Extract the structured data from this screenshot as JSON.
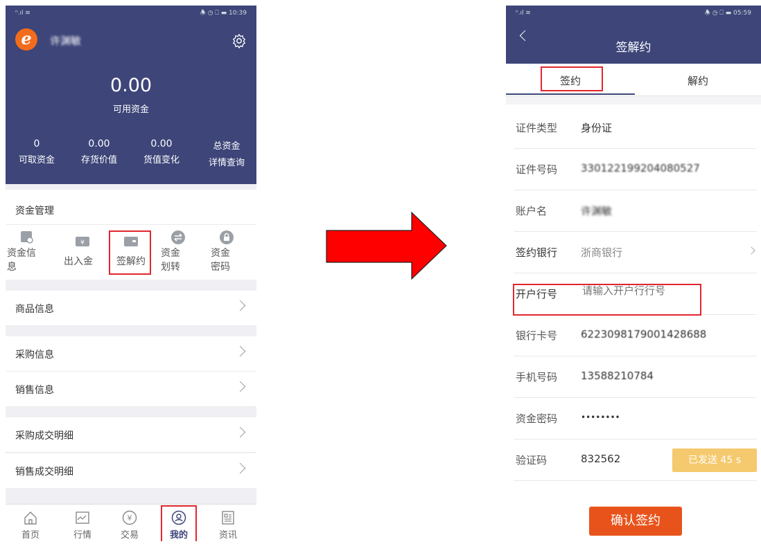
{
  "left": {
    "status": {
      "signal": "ⁿ.ıl ≋",
      "right": "🕭 ◷ ⎕ ▬ 10:39"
    },
    "user_name": "许渊敏",
    "balance": "0.00",
    "balance_label": "可用资金",
    "stats": [
      {
        "value": "0",
        "label": "可取资金"
      },
      {
        "value": "0.00",
        "label": "存货价值"
      },
      {
        "value": "0.00",
        "label": "货值变化"
      },
      {
        "value": "总资金",
        "label": "详情查询"
      }
    ],
    "fund_title": "资金管理",
    "functions": [
      {
        "label": "资金信息",
        "icon": "fund-info-icon"
      },
      {
        "label": "出入金",
        "icon": "deposit-icon"
      },
      {
        "label": "签解约",
        "icon": "wallet-icon"
      },
      {
        "label": "资金划转",
        "icon": "transfer-icon"
      },
      {
        "label": "资金密码",
        "icon": "lock-icon"
      }
    ],
    "menu": [
      "商品信息",
      "采购信息",
      "销售信息",
      "采购成交明细",
      "销售成交明细"
    ],
    "nav": [
      {
        "label": "首页",
        "icon": "home-icon"
      },
      {
        "label": "行情",
        "icon": "chart-icon"
      },
      {
        "label": "交易",
        "icon": "yen-icon"
      },
      {
        "label": "我的",
        "icon": "user-icon"
      },
      {
        "label": "资讯",
        "icon": "news-icon"
      }
    ],
    "accent": "#3d4579"
  },
  "right": {
    "status": {
      "signal": "ⁿ.ıl ≋",
      "right": "🕭 ◷ ⎕ ▬ 05:59"
    },
    "title": "签解约",
    "tabs": [
      "签约",
      "解约"
    ],
    "fields": [
      {
        "label": "证件类型",
        "value": "身份证"
      },
      {
        "label": "证件号码",
        "value": "330122199204080527"
      },
      {
        "label": "账户名",
        "value": "许渊敏"
      },
      {
        "label": "签约银行",
        "value": "浙商银行"
      },
      {
        "label": "开户行号",
        "placeholder": "请输入开户行行号"
      },
      {
        "label": "银行卡号",
        "value": "6223098179001428688"
      },
      {
        "label": "手机号码",
        "value": "13588210784"
      },
      {
        "label": "资金密码",
        "value": "••••••••"
      },
      {
        "label": "验证码",
        "value": "832562"
      }
    ],
    "sent_button": "已发送 45 s",
    "confirm_button": "确认签约",
    "button_color": "#e8531b"
  }
}
